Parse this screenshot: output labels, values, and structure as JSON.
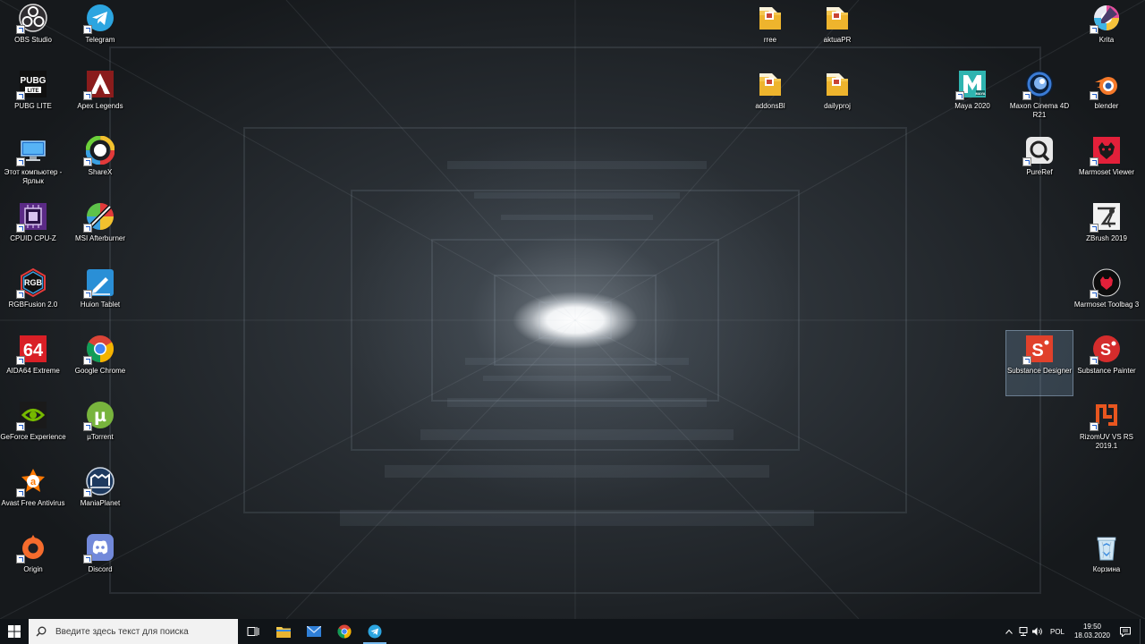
{
  "wallpaper": {
    "description_colors": {
      "light": "#ffffff",
      "dark": "#16191c"
    }
  },
  "desktop": {
    "icons": [
      {
        "id": "obs",
        "label": "OBS Studio",
        "icon": "obs-icon"
      },
      {
        "id": "telegram",
        "label": "Telegram",
        "icon": "telegram-icon"
      },
      {
        "id": "pubg",
        "label": "PUBG LITE",
        "icon": "pubg-icon"
      },
      {
        "id": "apex",
        "label": "Apex Legends",
        "icon": "apex-icon"
      },
      {
        "id": "thispc",
        "label": "Этот компьютер - Ярлык",
        "icon": "computer-icon"
      },
      {
        "id": "sharex",
        "label": "ShareX",
        "icon": "sharex-icon"
      },
      {
        "id": "cpuz",
        "label": "CPUID CPU-Z",
        "icon": "cpuz-icon"
      },
      {
        "id": "afterburner",
        "label": "MSI Afterburner",
        "icon": "afterburner-icon"
      },
      {
        "id": "rgbfusion",
        "label": "RGBFusion 2.0",
        "icon": "rgb-icon"
      },
      {
        "id": "huion",
        "label": "Huion Tablet",
        "icon": "huion-icon"
      },
      {
        "id": "aida64",
        "label": "AIDA64 Extreme",
        "icon": "aida64-icon",
        "text": "64"
      },
      {
        "id": "chrome",
        "label": "Google Chrome",
        "icon": "chrome-icon"
      },
      {
        "id": "geforce",
        "label": "GeForce Experience",
        "icon": "nvidia-icon"
      },
      {
        "id": "utorrent",
        "label": "µTorrent",
        "icon": "utorrent-icon"
      },
      {
        "id": "avast",
        "label": "Avast Free Antivirus",
        "icon": "avast-icon"
      },
      {
        "id": "maniaplanet",
        "label": "ManiaPlanet",
        "icon": "maniaplanet-icon"
      },
      {
        "id": "origin",
        "label": "Origin",
        "icon": "origin-icon"
      },
      {
        "id": "discord",
        "label": "Discord",
        "icon": "discord-icon"
      },
      {
        "id": "rree",
        "label": "rree",
        "icon": "folder-icon"
      },
      {
        "id": "aktuapr",
        "label": "aktuaPR",
        "icon": "folder-icon"
      },
      {
        "id": "addonsbl",
        "label": "addonsBl",
        "icon": "folder-icon"
      },
      {
        "id": "dailyproj",
        "label": "dailyproj",
        "icon": "folder-icon"
      },
      {
        "id": "maya",
        "label": "Maya 2020",
        "icon": "maya-icon"
      },
      {
        "id": "cinema4d",
        "label": "Maxon Cinema 4D R21",
        "icon": "cinema4d-icon"
      },
      {
        "id": "blender",
        "label": "blender",
        "icon": "blender-icon"
      },
      {
        "id": "krita",
        "label": "Krita",
        "icon": "krita-icon"
      },
      {
        "id": "pureref",
        "label": "PureRef",
        "icon": "pureref-icon"
      },
      {
        "id": "marmosetviewer",
        "label": "Marmoset Viewer",
        "icon": "marmoset-viewer-icon"
      },
      {
        "id": "zbrush",
        "label": "ZBrush 2019",
        "icon": "zbrush-icon"
      },
      {
        "id": "marmosettoolbag",
        "label": "Marmoset Toolbag 3",
        "icon": "marmoset-toolbag-icon"
      },
      {
        "id": "substancedesigner",
        "label": "Substance Designer",
        "icon": "substance-designer-icon",
        "selected": true
      },
      {
        "id": "substancepainter",
        "label": "Substance Painter",
        "icon": "substance-painter-icon"
      },
      {
        "id": "rizomuv",
        "label": "RizomUV VS RS 2019.1",
        "icon": "rizomuv-icon"
      },
      {
        "id": "recyclebin",
        "label": "Корзина",
        "icon": "recycle-bin-icon"
      }
    ]
  },
  "taskbar": {
    "search_placeholder": "Введите здесь текст для поиска",
    "pinned": [
      {
        "name": "task-view",
        "icon": "task-view-icon"
      },
      {
        "name": "file-explorer",
        "icon": "folder-icon"
      },
      {
        "name": "mail",
        "icon": "mail-icon"
      },
      {
        "name": "chrome",
        "icon": "chrome-icon"
      },
      {
        "name": "telegram",
        "icon": "telegram-icon",
        "active": true
      }
    ],
    "tray": {
      "language": "POL",
      "time": "19:50",
      "date": "18.03.2020"
    },
    "accent_color": "#76b9ed"
  }
}
